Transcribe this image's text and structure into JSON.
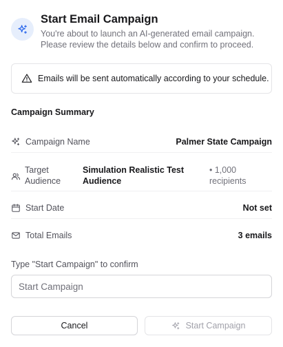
{
  "dialog": {
    "title": "Start Email Campaign",
    "description": "You're about to launch an AI-generated email campaign. Please review the details below and confirm to proceed.",
    "icon": "sparkles-icon",
    "accent_color": "#2563eb"
  },
  "alert": {
    "icon": "warning-triangle-icon",
    "text": "Emails will be sent automatically according to your schedule."
  },
  "summary": {
    "title": "Campaign Summary",
    "campaign_name": {
      "icon": "sparkles-icon",
      "label": "Campaign Name",
      "value": "Palmer State Campaign"
    },
    "target_audience": {
      "icon": "users-icon",
      "label": "Target Audience",
      "value": "Simulation Realistic Test Audience",
      "count": "• 1,000 recipients"
    },
    "start_date": {
      "icon": "calendar-icon",
      "label": "Start Date",
      "value": "Not set"
    },
    "total_emails": {
      "icon": "mail-icon",
      "label": "Total Emails",
      "value": "3 emails"
    }
  },
  "confirm": {
    "label": "Type \"Start Campaign\" to confirm",
    "placeholder": "Start Campaign",
    "value": ""
  },
  "buttons": {
    "cancel": "Cancel",
    "start": "Start Campaign",
    "start_icon": "sparkles-icon"
  }
}
